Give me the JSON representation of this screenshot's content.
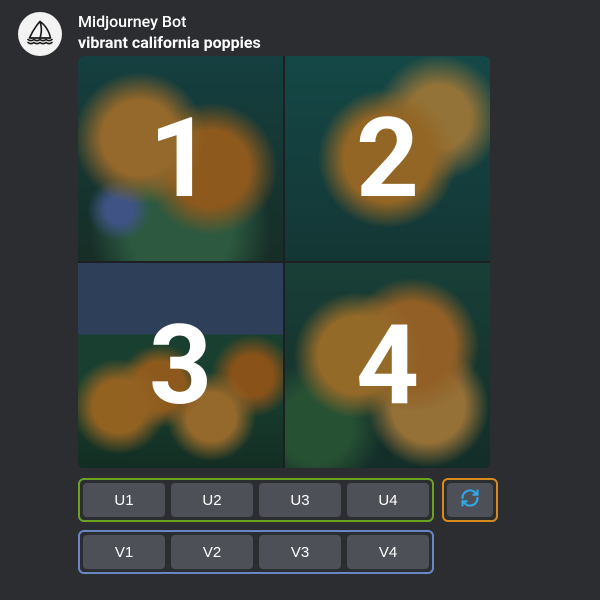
{
  "bot": {
    "name": "Midjourney Bot"
  },
  "prompt": "vibrant california poppies",
  "quadrants": [
    "1",
    "2",
    "3",
    "4"
  ],
  "buttons": {
    "upscale": [
      "U1",
      "U2",
      "U3",
      "U4"
    ],
    "variation": [
      "V1",
      "V2",
      "V3",
      "V4"
    ]
  }
}
